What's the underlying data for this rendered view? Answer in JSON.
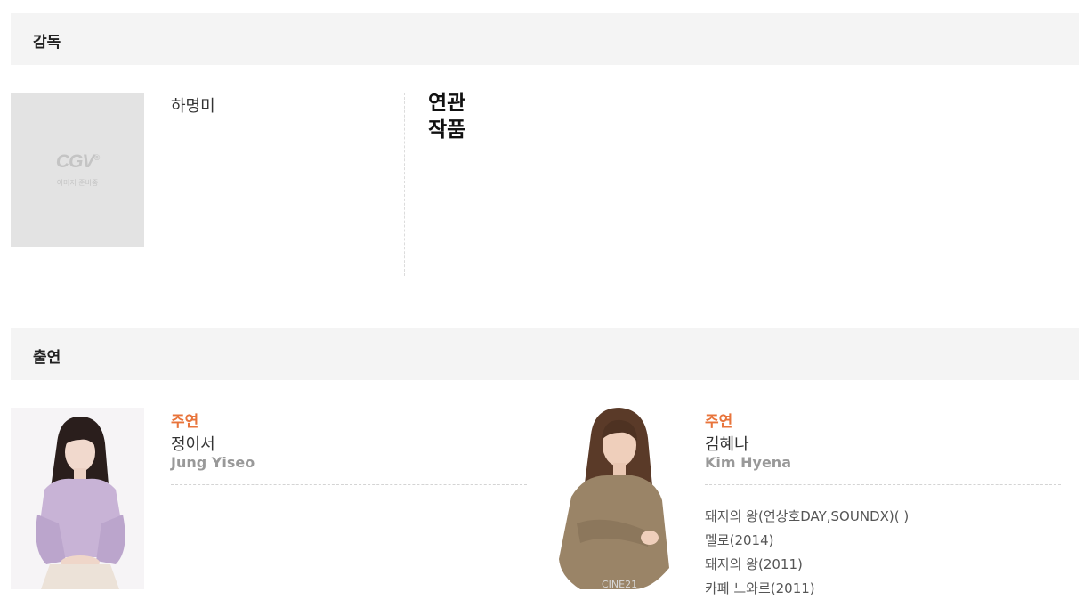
{
  "director_section": {
    "title": "감독",
    "photo": {
      "logo": "CGV",
      "logo_mark": "®",
      "placeholder_text": "이미지 준비중"
    },
    "name": "하명미",
    "related_works_title": "연관 작품"
  },
  "cast_section": {
    "title": "출연",
    "cast": [
      {
        "role": "주연",
        "name_ko": "정이서",
        "name_en": "Jung Yiseo",
        "works": []
      },
      {
        "role": "주연",
        "name_ko": "김혜나",
        "name_en": "Kim Hyena",
        "works": [
          "돼지의 왕(연상호DAY,SOUNDX)( )",
          "멜로(2014)",
          "돼지의 왕(2011)",
          "카페 느와르(2011)"
        ]
      }
    ]
  },
  "colors": {
    "role": "#e8743b",
    "section_bg": "#f4f4f4",
    "placeholder_bg": "#e3e3e3"
  }
}
